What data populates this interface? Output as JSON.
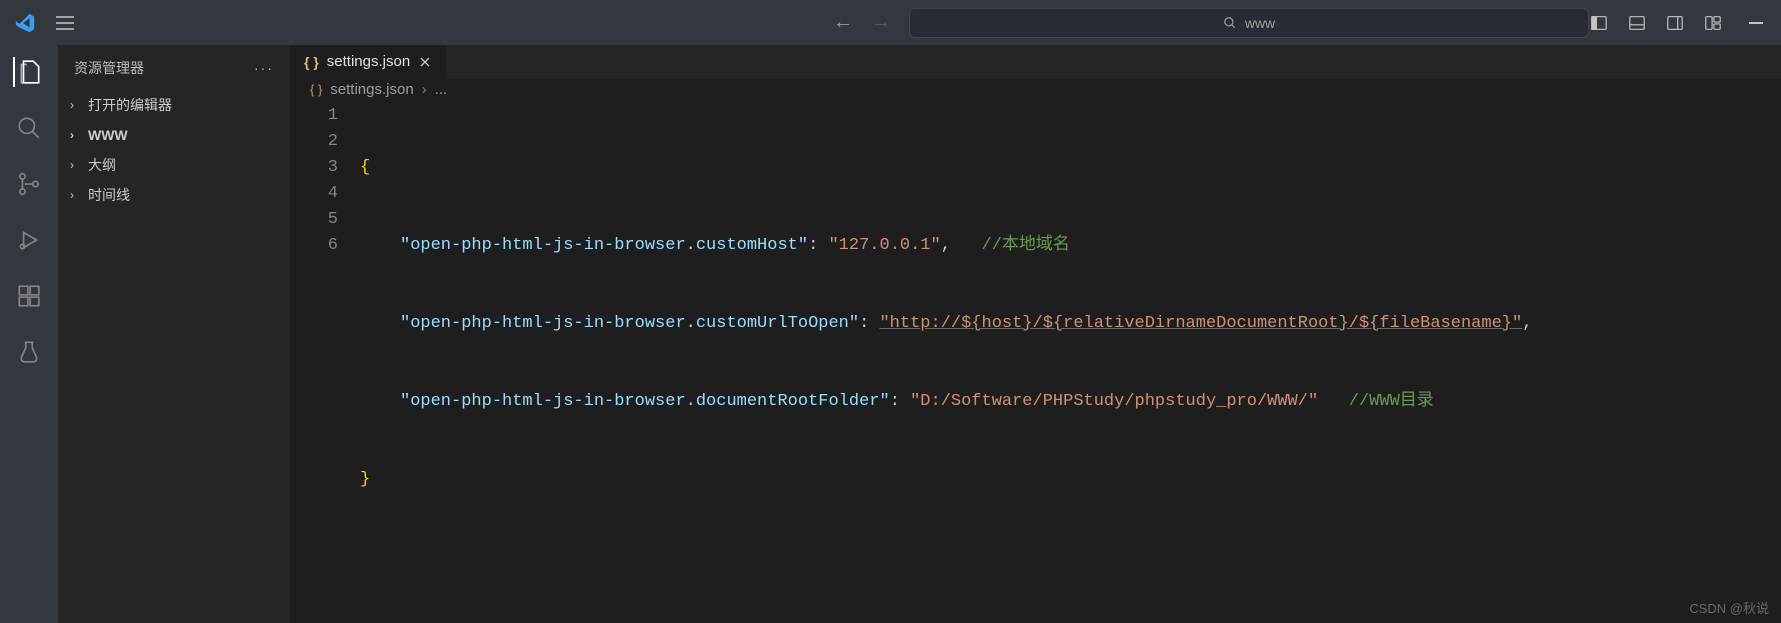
{
  "commandCenter": {
    "text": "www"
  },
  "sidebar": {
    "title": "资源管理器",
    "items": [
      {
        "label": "打开的编辑器"
      },
      {
        "label": "WWW"
      },
      {
        "label": "大纲"
      },
      {
        "label": "时间线"
      }
    ]
  },
  "tab": {
    "icon": "{ }",
    "name": "settings.json"
  },
  "breadcrumb": {
    "icon": "{ }",
    "name": "settings.json",
    "sep": "›",
    "tail": "..."
  },
  "lines": [
    "1",
    "2",
    "3",
    "4",
    "5",
    "6"
  ],
  "code": {
    "l1": {
      "brace": "{"
    },
    "l2": {
      "key": "\"open-php-html-js-in-browser.customHost\"",
      "colon": ": ",
      "val": "\"127.0.0.1\"",
      "comma": ",",
      "pad": "   ",
      "comment": "//本地域名"
    },
    "l3": {
      "key": "\"open-php-html-js-in-browser.customUrlToOpen\"",
      "colon": ": ",
      "val": "\"http://${host}/${relativeDirnameDocumentRoot}/${fileBasename}\"",
      "comma": ","
    },
    "l4": {
      "key": "\"open-php-html-js-in-browser.documentRootFolder\"",
      "colon": ": ",
      "val": "\"D:/Software/PHPStudy/phpstudy_pro/WWW/\"",
      "pad": "   ",
      "comment": "//WWW目录"
    },
    "l5": {
      "brace": "}"
    }
  },
  "watermark": "CSDN @秋说"
}
